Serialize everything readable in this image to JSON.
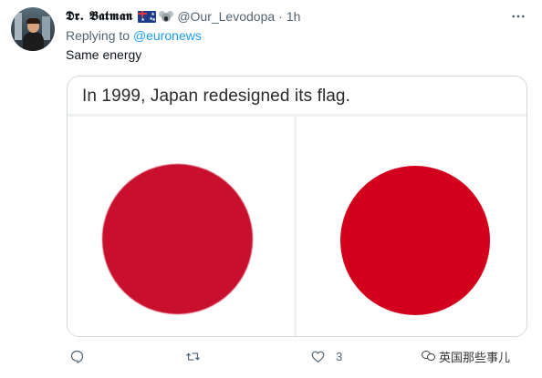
{
  "tweet": {
    "display_name": "𝕯𝖗. 𝕭𝖆𝖙𝖒𝖆𝖓",
    "handle": "@Our_Levodopa",
    "separator": "·",
    "time": "1h",
    "reply_prefix": "Replying to",
    "reply_to": "@euronews",
    "text": "Same energy",
    "badges": [
      "australia-flag-icon",
      "koala-icon"
    ]
  },
  "media": {
    "caption": "In 1999, Japan redesigned its flag.",
    "left_panel": "old-flag",
    "right_panel": "new-flag",
    "colors": {
      "old_sun": "#c8102e",
      "new_sun": "#d3001d"
    }
  },
  "actions": {
    "reply_icon": "reply-icon",
    "retweet_icon": "retweet-icon",
    "like_icon": "heart-icon",
    "like_count": "3"
  },
  "watermark": {
    "text": "英国那些事儿",
    "icon": "wechat-icon"
  },
  "colors": {
    "accent": "#1d9bf0",
    "secondary_text": "#536471"
  }
}
